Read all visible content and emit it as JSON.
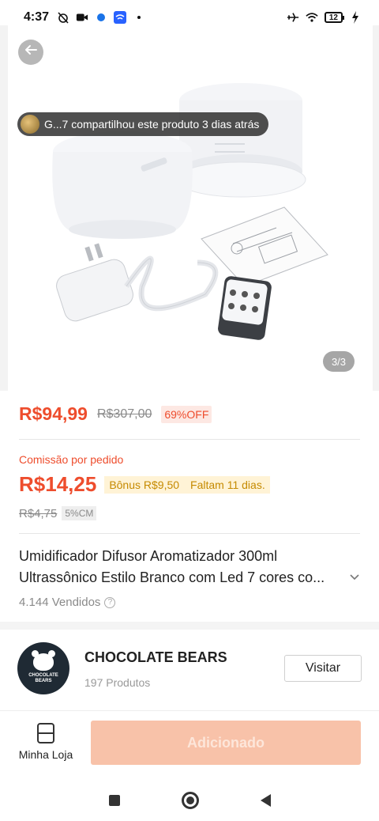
{
  "status_bar": {
    "time": "4:37",
    "battery": "12"
  },
  "product": {
    "share_text": "G...7 compartilhou este produto 3 dias atrás",
    "image_counter": "3/3",
    "price": "R$94,99",
    "original_price": "R$307,00",
    "discount": "69%OFF",
    "commission_label": "Comissão por pedido",
    "commission_value": "R$14,25",
    "bonus": "Bônus R$9,50",
    "bonus_deadline": "Faltam 11 dias.",
    "commission_old": "R$4,75",
    "commission_rate": "5%CM",
    "title_line_1": "Umidificador Difusor Aromatizador 300ml",
    "title_line_2": "Ultrassônico Estilo Branco com Led 7 cores co...",
    "sold": "4.144 Vendidos"
  },
  "shop": {
    "logo_text": "CHOCOLATE BEARS",
    "name": "CHOCOLATE BEARS",
    "products": "197 Produtos",
    "visit_label": "Visitar"
  },
  "actions": {
    "my_shop_label": "Minha Loja",
    "add_label": "Adicionado"
  },
  "colors": {
    "accent": "#ee4d2d",
    "add_button_disabled": "#f8c2a9",
    "bonus_bg": "#fff3d6"
  }
}
